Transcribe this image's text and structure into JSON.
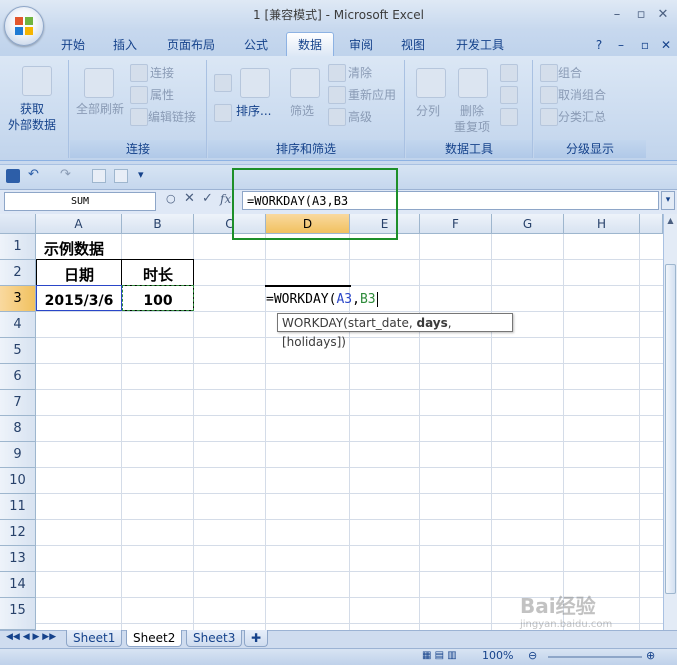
{
  "window": {
    "title": "1  [兼容模式] - Microsoft Excel"
  },
  "tabs": [
    "开始",
    "插入",
    "页面布局",
    "公式",
    "数据",
    "审阅",
    "视图",
    "开发工具"
  ],
  "active_tab": "数据",
  "ribbon": {
    "get_external": {
      "line1": "获取",
      "line2": "外部数据"
    },
    "refresh_all": "全部刷新",
    "connections": "连接",
    "properties": "属性",
    "edit_links": "编辑链接",
    "sort": "排序...",
    "filter": "筛选",
    "clear": "清除",
    "reapply": "重新应用",
    "advanced": "高级",
    "split": "分列",
    "remove_duplicates_line1": "删除",
    "remove_duplicates_line2": "重复项",
    "group": "组合",
    "ungroup": "取消组合",
    "subtotal": "分类汇总",
    "group_labels": [
      "连接",
      "排序和筛选",
      "数据工具",
      "分级显示"
    ]
  },
  "formula_bar": {
    "name_box": "SUM",
    "fx": "fx",
    "formula": "=WORKDAY(A3,B3"
  },
  "columns": [
    "A",
    "B",
    "C",
    "D",
    "E",
    "F",
    "G",
    "H"
  ],
  "rows": [
    "1",
    "2",
    "3",
    "4",
    "5",
    "6",
    "7",
    "8",
    "9",
    "10",
    "11",
    "12",
    "13",
    "14",
    "15"
  ],
  "cells": {
    "A1": "示例数据",
    "A2": "日期",
    "B2": "时长",
    "A3": "2015/3/6",
    "B3": "100",
    "D3_prefix": "=WORKDAY(",
    "D3_ref1": "A3",
    "D3_comma": ",",
    "D3_ref2": "B3"
  },
  "tooltip": {
    "fn": "WORKDAY(start_date, ",
    "bold_arg": "days",
    "rest": ", [holidays])"
  },
  "sheets": [
    "Sheet1",
    "Sheet2",
    "Sheet3"
  ],
  "active_sheet": "Sheet2",
  "status": {
    "zoom": "100%"
  },
  "watermark": "Bai经验",
  "watermark_url": "jingyan.baidu.com",
  "colors": {
    "green_highlight": "#1d8f29",
    "ref_blue": "#2a46c8",
    "ref_green": "#2e8b3a"
  }
}
